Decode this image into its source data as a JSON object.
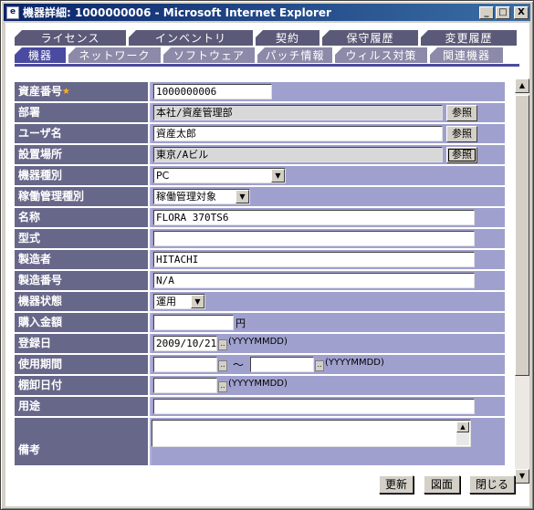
{
  "window": {
    "title": "機器詳細: 1000000006 - Microsoft Internet Explorer",
    "minimize": "_",
    "maximize": "□",
    "close": "X"
  },
  "tabs_top": [
    "ライセンス",
    "インベントリ",
    "契約",
    "保守履歴",
    "変更履歴"
  ],
  "tabs_bottom": [
    "機器",
    "ネットワーク",
    "ソフトウェア",
    "パッチ情報",
    "ウィルス対策",
    "関連機器"
  ],
  "active_tab": "機器",
  "fields": {
    "asset_no": {
      "label": "資産番号",
      "required_mark": "★",
      "value": "1000000006"
    },
    "department": {
      "label": "部署",
      "value": "本社/資産管理部",
      "button": "参照"
    },
    "user_name": {
      "label": "ユーザ名",
      "value": "資産太郎",
      "button": "参照"
    },
    "location": {
      "label": "設置場所",
      "value": "東京/Aビル",
      "button": "参照"
    },
    "device_type": {
      "label": "機器種別",
      "value": "PC"
    },
    "operation_type": {
      "label": "稼働管理種別",
      "value": "稼働管理対象"
    },
    "name": {
      "label": "名称",
      "value": "FLORA 370TS6"
    },
    "model": {
      "label": "型式",
      "value": ""
    },
    "manufacturer": {
      "label": "製造者",
      "value": "HITACHI"
    },
    "serial_no": {
      "label": "製造番号",
      "value": "N/A"
    },
    "status": {
      "label": "機器状態",
      "value": "運用"
    },
    "purchase_price": {
      "label": "購入金額",
      "value": "",
      "unit": "円"
    },
    "registered_date": {
      "label": "登録日",
      "value": "2009/10/21",
      "format": "(YYYYMMDD)"
    },
    "usage_period": {
      "label": "使用期間",
      "from": "",
      "to": "",
      "separator": "～",
      "format": "(YYYYMMDD)"
    },
    "inventory_date": {
      "label": "棚卸日付",
      "value": "",
      "format": "(YYYYMMDD)"
    },
    "purpose": {
      "label": "用途",
      "value": ""
    },
    "remarks": {
      "label": "備考",
      "value": ""
    }
  },
  "buttons": {
    "update": "更新",
    "drawing": "図面",
    "close": "閉じる"
  },
  "colors": {
    "titlebar": "#0a246a",
    "label_bg": "#67678a",
    "value_bg": "#a0a0cf",
    "tab_active": "#4a4aa0"
  }
}
